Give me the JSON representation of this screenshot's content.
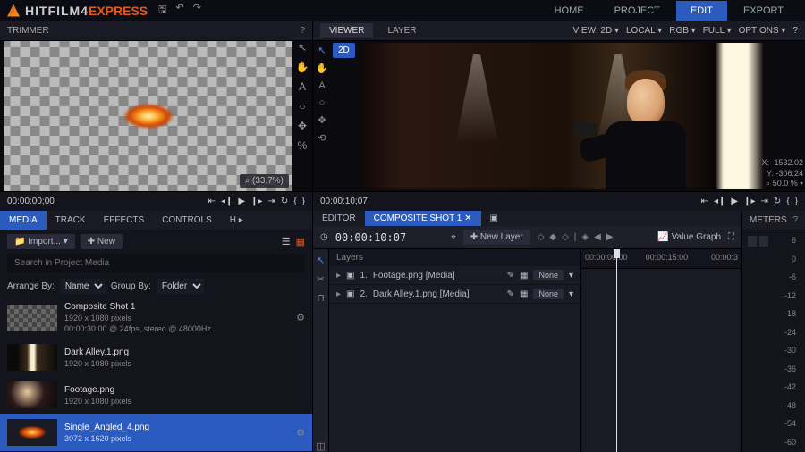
{
  "app": {
    "name_a": "HITFILM4",
    "name_b": "EXPRESS"
  },
  "nav": {
    "home": "HOME",
    "project": "PROJECT",
    "edit": "EDIT",
    "export": "EXPORT"
  },
  "trimmer": {
    "title": "TRIMMER",
    "file": "Single_Angled_4.png",
    "zoom": "(33,7%)"
  },
  "transport": {
    "time": "00:00:00;00"
  },
  "media": {
    "tabs": {
      "media": "MEDIA",
      "track": "TRACK",
      "effects": "EFFECTS",
      "controls": "CONTROLS",
      "more": "H ▸"
    },
    "import": "Import...",
    "new": "New",
    "search_ph": "Search in Project Media",
    "arrange_lbl": "Arrange By:",
    "arrange_val": "Name",
    "group_lbl": "Group By:",
    "group_val": "Folder",
    "items": [
      {
        "name": "Composite Shot 1",
        "meta1": "1920 x 1080 pixels",
        "meta2": "00:00:30;00 @ 24fps, stereo @ 48000Hz"
      },
      {
        "name": "Dark Alley.1.png",
        "meta1": "1920 x 1080 pixels"
      },
      {
        "name": "Footage.png",
        "meta1": "1920 x 1080 pixels"
      },
      {
        "name": "Single_Angled_4.png",
        "meta1": "3072 x 1620 pixels"
      }
    ]
  },
  "viewer": {
    "title": "VIEWER",
    "layer": "LAYER",
    "view": "VIEW: 2D",
    "local": "LOCAL",
    "rgb": "RGB",
    "full": "FULL",
    "options": "OPTIONS",
    "mode": "2D",
    "x_lbl": "X:",
    "x": "-1532.02",
    "y_lbl": "Y:",
    "y": "-306.24",
    "zoom": "50.0 %"
  },
  "transport2": {
    "time": "00:00:10;07"
  },
  "editor": {
    "tab_editor": "EDITOR",
    "tab_comp": "COMPOSITE SHOT 1",
    "tc": "00:00:10:07",
    "newlayer": "New Layer",
    "vgraph": "Value Graph",
    "layers_hdr": "Layers",
    "layers": [
      {
        "idx": "1.",
        "name": "Footage.png [Media]",
        "mode": "None"
      },
      {
        "idx": "2.",
        "name": "Dark Alley.1.png [Media]",
        "mode": "None"
      }
    ],
    "ruler": {
      "t0": "00:00:00:00",
      "t1": "00:00:15:00",
      "t2": "00:00:3"
    }
  },
  "meters": {
    "title": "METERS",
    "ticks": [
      "6",
      "0",
      "-6",
      "-12",
      "-18",
      "-24",
      "-30",
      "-36",
      "-42",
      "-48",
      "-54",
      "-60"
    ]
  }
}
